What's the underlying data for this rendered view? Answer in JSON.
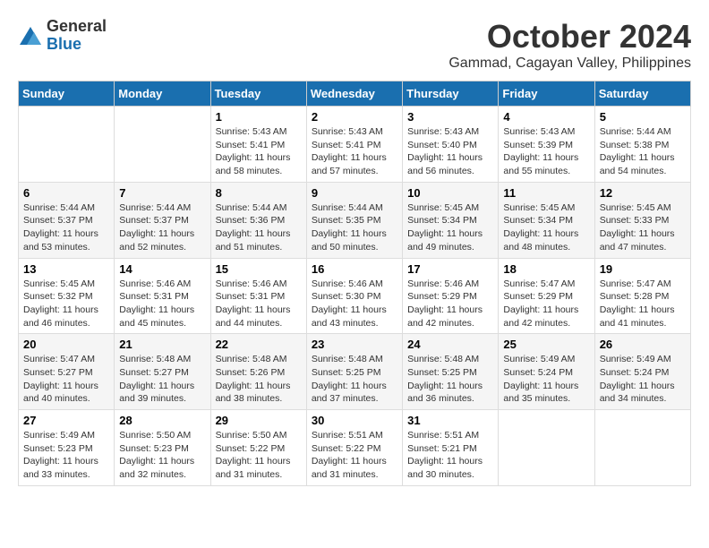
{
  "logo": {
    "general": "General",
    "blue": "Blue"
  },
  "title": "October 2024",
  "subtitle": "Gammad, Cagayan Valley, Philippines",
  "weekdays": [
    "Sunday",
    "Monday",
    "Tuesday",
    "Wednesday",
    "Thursday",
    "Friday",
    "Saturday"
  ],
  "weeks": [
    [
      {
        "day": "",
        "info": ""
      },
      {
        "day": "",
        "info": ""
      },
      {
        "day": "1",
        "info": "Sunrise: 5:43 AM\nSunset: 5:41 PM\nDaylight: 11 hours and 58 minutes."
      },
      {
        "day": "2",
        "info": "Sunrise: 5:43 AM\nSunset: 5:41 PM\nDaylight: 11 hours and 57 minutes."
      },
      {
        "day": "3",
        "info": "Sunrise: 5:43 AM\nSunset: 5:40 PM\nDaylight: 11 hours and 56 minutes."
      },
      {
        "day": "4",
        "info": "Sunrise: 5:43 AM\nSunset: 5:39 PM\nDaylight: 11 hours and 55 minutes."
      },
      {
        "day": "5",
        "info": "Sunrise: 5:44 AM\nSunset: 5:38 PM\nDaylight: 11 hours and 54 minutes."
      }
    ],
    [
      {
        "day": "6",
        "info": "Sunrise: 5:44 AM\nSunset: 5:37 PM\nDaylight: 11 hours and 53 minutes."
      },
      {
        "day": "7",
        "info": "Sunrise: 5:44 AM\nSunset: 5:37 PM\nDaylight: 11 hours and 52 minutes."
      },
      {
        "day": "8",
        "info": "Sunrise: 5:44 AM\nSunset: 5:36 PM\nDaylight: 11 hours and 51 minutes."
      },
      {
        "day": "9",
        "info": "Sunrise: 5:44 AM\nSunset: 5:35 PM\nDaylight: 11 hours and 50 minutes."
      },
      {
        "day": "10",
        "info": "Sunrise: 5:45 AM\nSunset: 5:34 PM\nDaylight: 11 hours and 49 minutes."
      },
      {
        "day": "11",
        "info": "Sunrise: 5:45 AM\nSunset: 5:34 PM\nDaylight: 11 hours and 48 minutes."
      },
      {
        "day": "12",
        "info": "Sunrise: 5:45 AM\nSunset: 5:33 PM\nDaylight: 11 hours and 47 minutes."
      }
    ],
    [
      {
        "day": "13",
        "info": "Sunrise: 5:45 AM\nSunset: 5:32 PM\nDaylight: 11 hours and 46 minutes."
      },
      {
        "day": "14",
        "info": "Sunrise: 5:46 AM\nSunset: 5:31 PM\nDaylight: 11 hours and 45 minutes."
      },
      {
        "day": "15",
        "info": "Sunrise: 5:46 AM\nSunset: 5:31 PM\nDaylight: 11 hours and 44 minutes."
      },
      {
        "day": "16",
        "info": "Sunrise: 5:46 AM\nSunset: 5:30 PM\nDaylight: 11 hours and 43 minutes."
      },
      {
        "day": "17",
        "info": "Sunrise: 5:46 AM\nSunset: 5:29 PM\nDaylight: 11 hours and 42 minutes."
      },
      {
        "day": "18",
        "info": "Sunrise: 5:47 AM\nSunset: 5:29 PM\nDaylight: 11 hours and 42 minutes."
      },
      {
        "day": "19",
        "info": "Sunrise: 5:47 AM\nSunset: 5:28 PM\nDaylight: 11 hours and 41 minutes."
      }
    ],
    [
      {
        "day": "20",
        "info": "Sunrise: 5:47 AM\nSunset: 5:27 PM\nDaylight: 11 hours and 40 minutes."
      },
      {
        "day": "21",
        "info": "Sunrise: 5:48 AM\nSunset: 5:27 PM\nDaylight: 11 hours and 39 minutes."
      },
      {
        "day": "22",
        "info": "Sunrise: 5:48 AM\nSunset: 5:26 PM\nDaylight: 11 hours and 38 minutes."
      },
      {
        "day": "23",
        "info": "Sunrise: 5:48 AM\nSunset: 5:25 PM\nDaylight: 11 hours and 37 minutes."
      },
      {
        "day": "24",
        "info": "Sunrise: 5:48 AM\nSunset: 5:25 PM\nDaylight: 11 hours and 36 minutes."
      },
      {
        "day": "25",
        "info": "Sunrise: 5:49 AM\nSunset: 5:24 PM\nDaylight: 11 hours and 35 minutes."
      },
      {
        "day": "26",
        "info": "Sunrise: 5:49 AM\nSunset: 5:24 PM\nDaylight: 11 hours and 34 minutes."
      }
    ],
    [
      {
        "day": "27",
        "info": "Sunrise: 5:49 AM\nSunset: 5:23 PM\nDaylight: 11 hours and 33 minutes."
      },
      {
        "day": "28",
        "info": "Sunrise: 5:50 AM\nSunset: 5:23 PM\nDaylight: 11 hours and 32 minutes."
      },
      {
        "day": "29",
        "info": "Sunrise: 5:50 AM\nSunset: 5:22 PM\nDaylight: 11 hours and 31 minutes."
      },
      {
        "day": "30",
        "info": "Sunrise: 5:51 AM\nSunset: 5:22 PM\nDaylight: 11 hours and 31 minutes."
      },
      {
        "day": "31",
        "info": "Sunrise: 5:51 AM\nSunset: 5:21 PM\nDaylight: 11 hours and 30 minutes."
      },
      {
        "day": "",
        "info": ""
      },
      {
        "day": "",
        "info": ""
      }
    ]
  ]
}
